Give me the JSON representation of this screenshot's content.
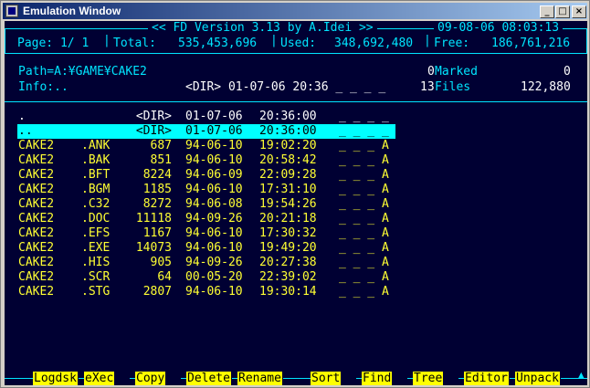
{
  "window": {
    "title": "Emulation Window",
    "minimize": "_",
    "maximize": "□",
    "close": "×"
  },
  "header": {
    "version": "<< FD Version 3.13 by A.Idei >>",
    "datetime": "09-08-06 08:03:13",
    "page": "Page: 1/ 1",
    "total_label": "Total:",
    "total_value": "535,453,696",
    "used_label": "Used:",
    "used_value": "348,692,480",
    "free_label": "Free:",
    "free_value": "186,761,216"
  },
  "info": {
    "path": "Path=A:¥GAME¥CAKE2",
    "marked_count": "0",
    "marked_label": "Marked",
    "marked_value": "0",
    "info_label": "Info:..",
    "info_detail": "<DIR> 01-07-06 20:36 _ _ _ _",
    "files_count": "13",
    "files_label": "Files",
    "files_value": "122,880"
  },
  "files": [
    {
      "name": ".",
      "ext": "",
      "size": "<DIR>",
      "date": "01-07-06",
      "time": "20:36:00",
      "attr": "_ _ _ _",
      "color": "#ffffff"
    },
    {
      "name": "..",
      "ext": "",
      "size": "<DIR>",
      "date": "01-07-06",
      "time": "20:36:00",
      "attr": "_ _ _ _",
      "color": "#000000",
      "selected": true
    },
    {
      "name": "CAKE2",
      "ext": ".ANK",
      "size": "687",
      "date": "94-06-10",
      "time": "19:02:20",
      "attr": "_ _ _ A",
      "color": "#ffff33"
    },
    {
      "name": "CAKE2",
      "ext": ".BAK",
      "size": "851",
      "date": "94-06-10",
      "time": "20:58:42",
      "attr": "_ _ _ A",
      "color": "#ffff33"
    },
    {
      "name": "CAKE2",
      "ext": ".BFT",
      "size": "8224",
      "date": "94-06-09",
      "time": "22:09:28",
      "attr": "_ _ _ A",
      "color": "#ffff33"
    },
    {
      "name": "CAKE2",
      "ext": ".BGM",
      "size": "1185",
      "date": "94-06-10",
      "time": "17:31:10",
      "attr": "_ _ _ A",
      "color": "#ffff33"
    },
    {
      "name": "CAKE2",
      "ext": ".C32",
      "size": "8272",
      "date": "94-06-08",
      "time": "19:54:26",
      "attr": "_ _ _ A",
      "color": "#ffff33"
    },
    {
      "name": "CAKE2",
      "ext": ".DOC",
      "size": "11118",
      "date": "94-09-26",
      "time": "20:21:18",
      "attr": "_ _ _ A",
      "color": "#ffff33"
    },
    {
      "name": "CAKE2",
      "ext": ".EFS",
      "size": "1167",
      "date": "94-06-10",
      "time": "17:30:32",
      "attr": "_ _ _ A",
      "color": "#ffff33"
    },
    {
      "name": "CAKE2",
      "ext": ".EXE",
      "size": "14073",
      "date": "94-06-10",
      "time": "19:49:20",
      "attr": "_ _ _ A",
      "color": "#ffff33"
    },
    {
      "name": "CAKE2",
      "ext": ".HIS",
      "size": "905",
      "date": "94-09-26",
      "time": "20:27:38",
      "attr": "_ _ _ A",
      "color": "#ffff33"
    },
    {
      "name": "CAKE2",
      "ext": ".SCR",
      "size": "64",
      "date": "00-05-20",
      "time": "22:39:02",
      "attr": "_ _ _ A",
      "color": "#ffff33"
    },
    {
      "name": "CAKE2",
      "ext": ".STG",
      "size": "2807",
      "date": "94-06-10",
      "time": "19:30:14",
      "attr": "_ _ _ A",
      "color": "#ffff33"
    }
  ],
  "function_keys": [
    {
      "hot": "L",
      "rest": "ogdsk"
    },
    {
      "hot": "e",
      "rest": "X",
      "pre": "",
      "label_override": "eXec"
    },
    {
      "hot": "C",
      "rest": "opy"
    },
    {
      "hot": "D",
      "rest": "elete"
    },
    {
      "hot": "R",
      "rest": "ename"
    },
    {
      "hot": "S",
      "rest": "ort"
    },
    {
      "hot": "F",
      "rest": "ind"
    },
    {
      "hot": "T",
      "rest": "ree"
    },
    {
      "hot": "E",
      "rest": "ditor"
    },
    {
      "hot": "U",
      "rest": "npack"
    }
  ],
  "colors": {
    "background": "#000033",
    "frame": "#00e5ff",
    "file": "#ffff33",
    "selection": "#00ffff",
    "key_bg": "#ffff00"
  }
}
